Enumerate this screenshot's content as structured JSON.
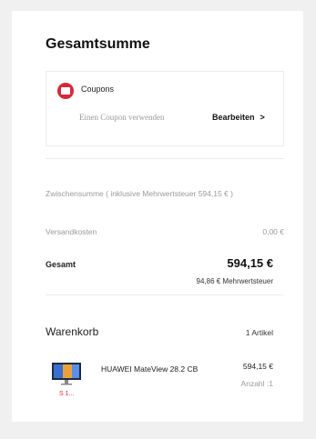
{
  "summary": {
    "title": "Gesamtsumme"
  },
  "coupon": {
    "label": "Coupons",
    "placeholder": "Einen Coupon verwenden",
    "edit_label": "Bearbeiten",
    "chevron": ">",
    "icon": "coupon-icon",
    "icon_color": "#d7283b"
  },
  "totals": {
    "subtotal_label": "Zwischensumme ( inklusive Mehrwertsteuer 594,15 € )",
    "shipping_label": "Versandkosten",
    "shipping_value": "0,00 €",
    "total_label": "Gesamt",
    "total_value": "594,15 €",
    "vat_note": "94,86 € Mehrwertsteuer"
  },
  "cart": {
    "title": "Warenkorb",
    "count": "1 Artikel",
    "items": [
      {
        "name": "HUAWEI MateView 28.2 CB",
        "price": "594,15 €",
        "quantity": "Anzahl :1",
        "thumb_label": "S 1..."
      }
    ]
  }
}
